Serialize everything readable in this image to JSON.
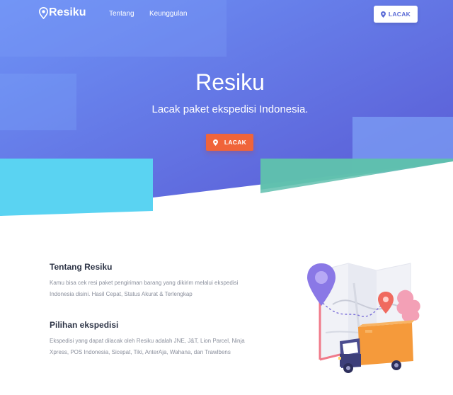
{
  "nav": {
    "brand": "Resiku",
    "links": [
      "Tentang",
      "Keunggulan"
    ],
    "button_label": "LACAK"
  },
  "hero": {
    "title": "Resiku",
    "subtitle": "Lacak paket ekspedisi Indonesia.",
    "cta_label": "LACAK"
  },
  "about": {
    "title": "Tentang Resiku",
    "text": "Kamu bisa cek resi paket pengiriman barang yang dikirim melalui ekspedisi Indonesia disini. Hasil Cepat, Status Akurat & Terlengkap"
  },
  "couriers": {
    "title": "Pilihan ekspedisi",
    "text": "Ekspedisi yang dapat dilacak oleh Resiku adalah JNE, J&T, Lion Parcel, Ninja Xpress, POS Indonesia, Sicepat, Tiki, AnterAja, Wahana, dan Trawlbens"
  },
  "colors": {
    "hero_gradient_start": "#6c8ef5",
    "hero_gradient_end": "#5b5cd6",
    "cta": "#f0643a",
    "accent_cyan": "#5ad3f2",
    "accent_teal": "#5fbfae"
  },
  "icons": {
    "brand": "location-pin-icon",
    "button": "location-pin-icon",
    "illustration": "map-delivery-truck-illustration"
  }
}
